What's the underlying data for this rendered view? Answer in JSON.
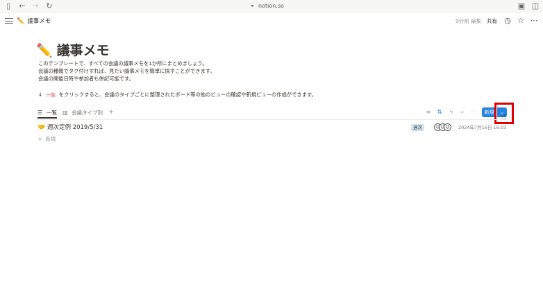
{
  "browser": {
    "url": "notion.so"
  },
  "topbar": {
    "breadcrumb_emoji": "✏️",
    "breadcrumb": "議事メモ",
    "edited": "9分前 編集",
    "share": "共有"
  },
  "page": {
    "title_emoji": "✏️",
    "title": "議事メモ",
    "description": [
      "このテンプレートで、すべての会議の議事メモを1か所にまとめましょう。",
      "会議の種類でタグ付けすれば、見たい議事メモを簡単に探すことができます。",
      "会議の開催日時や参加者も併記可能です。"
    ],
    "hint_arrow": "↓",
    "hint_code": "一覧",
    "hint_text": "をクリックすると、会議のタイプごとに整理されたボード等の他のビューの確認や新規ビューの作成ができます。"
  },
  "views": {
    "tabs": [
      {
        "label": "一覧",
        "icon": "list-icon",
        "active": true
      },
      {
        "label": "会議タイプ別",
        "icon": "board-icon",
        "active": false
      }
    ],
    "add": "+",
    "new_button": "新規"
  },
  "rows": [
    {
      "emoji": "🤝",
      "name": "週次定例 2019/5/31",
      "tag": "週次",
      "date": "2024年7月16日 16:03"
    }
  ],
  "new_row": "新規",
  "colors": {
    "accent": "#2383e2",
    "highlight": "#e00000",
    "tag_bg": "#d3e5ef"
  }
}
